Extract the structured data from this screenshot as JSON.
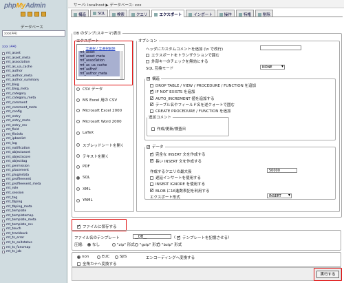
{
  "sidebar": {
    "logo_php": "php",
    "logo_my": "My",
    "logo_admin": "Admin",
    "db_label": "データベース",
    "db_select": "xxx(44)",
    "db_name": "xxx (44)",
    "tables": [
      "mt_asset",
      "mt_asset_meta",
      "mt_association",
      "mt_as_ua_cache",
      "mt_author",
      "mt_author_meta",
      "mt_author_summary",
      "mt_blog",
      "mt_blog_meta",
      "mt_category",
      "mt_category_meta",
      "mt_comment",
      "mt_comment_meta",
      "mt_config",
      "mt_entry",
      "mt_entry_meta",
      "mt_entry_rev",
      "mt_field",
      "mt_fileinfo",
      "mt_ipbanlist",
      "mt_log",
      "mt_notification",
      "mt_objectasset",
      "mt_objectscore",
      "mt_objecttag",
      "mt_permission",
      "mt_placement",
      "mt_plugindata",
      "mt_profileevent",
      "mt_profileevent_meta",
      "mt_role",
      "mt_session",
      "mt_tag",
      "mt_tbping",
      "mt_tbping_meta",
      "mt_template",
      "mt_templatemap",
      "mt_template_meta",
      "mt_template_rev",
      "mt_touch",
      "mt_trackback",
      "mt_ts_error",
      "mt_ts_exitstatus",
      "mt_ts_funcmap",
      "mt_ts_job"
    ]
  },
  "header": {
    "server": "サーバ: localhost ▶ データベース: xxx"
  },
  "tabs": [
    "構造",
    "SQL",
    "検索",
    "クエリ",
    "エクスポート",
    "インポート",
    "操作",
    "特権",
    "削除"
  ],
  "dump": {
    "legend": "DB のダンプ(スキーマ)表示",
    "export_legend": "エクスポート",
    "select_links": "全選択 / 全選択解除",
    "selected_tables": [
      "mt_asset",
      "mt_asset_meta",
      "mt_association",
      "mt_as_ua_cache",
      "mt_author",
      "mt_author_meta"
    ],
    "formats": [
      "CSV データ",
      "MS Excel 用の CSV",
      "Microsoft Excel 2000",
      "Microsoft Word 2000",
      "LaTeX",
      "スプレッドシートを開く",
      "テキストを開く",
      "PDF",
      "SQL",
      "XML",
      "YAML"
    ],
    "selected_format": "SQL"
  },
  "options": {
    "legend": "オプション",
    "header_comment": "ヘッダにカスタムコメントを追加 (\\n で改行)",
    "transaction": "エクスポートをトランザクションで囲む",
    "fk_checks": "外部キーのチェックを無効にする",
    "compat_label": "SQL 互換モード",
    "compat_value": "NONE",
    "structure_legend": "構造",
    "structure_opts": [
      {
        "label": "DROP TABLE / VIEW / PROCEDURE / FUNCTION を追加",
        "checked": false
      },
      {
        "label": "IF NOT EXISTS を追加",
        "checked": true
      },
      {
        "label": "AUTO_INCREMENT 値を追加する",
        "checked": true
      },
      {
        "label": "テーブル名やフィールド名を逆クォートで囲む",
        "checked": true
      },
      {
        "label": "CREATE PROCEDURE / FUNCTION を追加",
        "checked": false
      }
    ],
    "comment_legend": "追加コメント",
    "comment_opt": "作成/更新/検査日",
    "data_legend": "データ",
    "data_opts": [
      {
        "label": "完全な INSERT 文を作成する",
        "checked": true
      },
      {
        "label": "長い INSERT 文を作成する",
        "checked": true
      }
    ],
    "max_query_label": "作成するクエリの最大長",
    "max_query_value": "50000",
    "data_opts2": [
      {
        "label": "遅延インサートを使用する",
        "checked": false
      },
      {
        "label": "INSERT IGNORE を使用する",
        "checked": false
      },
      {
        "label": "BLOB に16進数表記を利用する",
        "checked": true
      }
    ],
    "export_type_label": "エクスポート形式",
    "export_type_value": "INSERT"
  },
  "file": {
    "save_label": "ファイルに保存する",
    "template_label": "ファイル名のテンプレート",
    "template_value": "__DB__",
    "remember_label": "テンプレートを記憶させる",
    "compress_label": "圧縮:",
    "compress_opts": [
      "なし",
      "\"zip\" 形式",
      "\"gzip\" 形式",
      "\"bzip\" 形式"
    ]
  },
  "encoding": {
    "opts": [
      "non",
      "EUC",
      "SJIS"
    ],
    "convert_label": "エンコーディングへ変換する",
    "kana_label": "全角カナへ変換する"
  },
  "go_button": "実行する"
}
